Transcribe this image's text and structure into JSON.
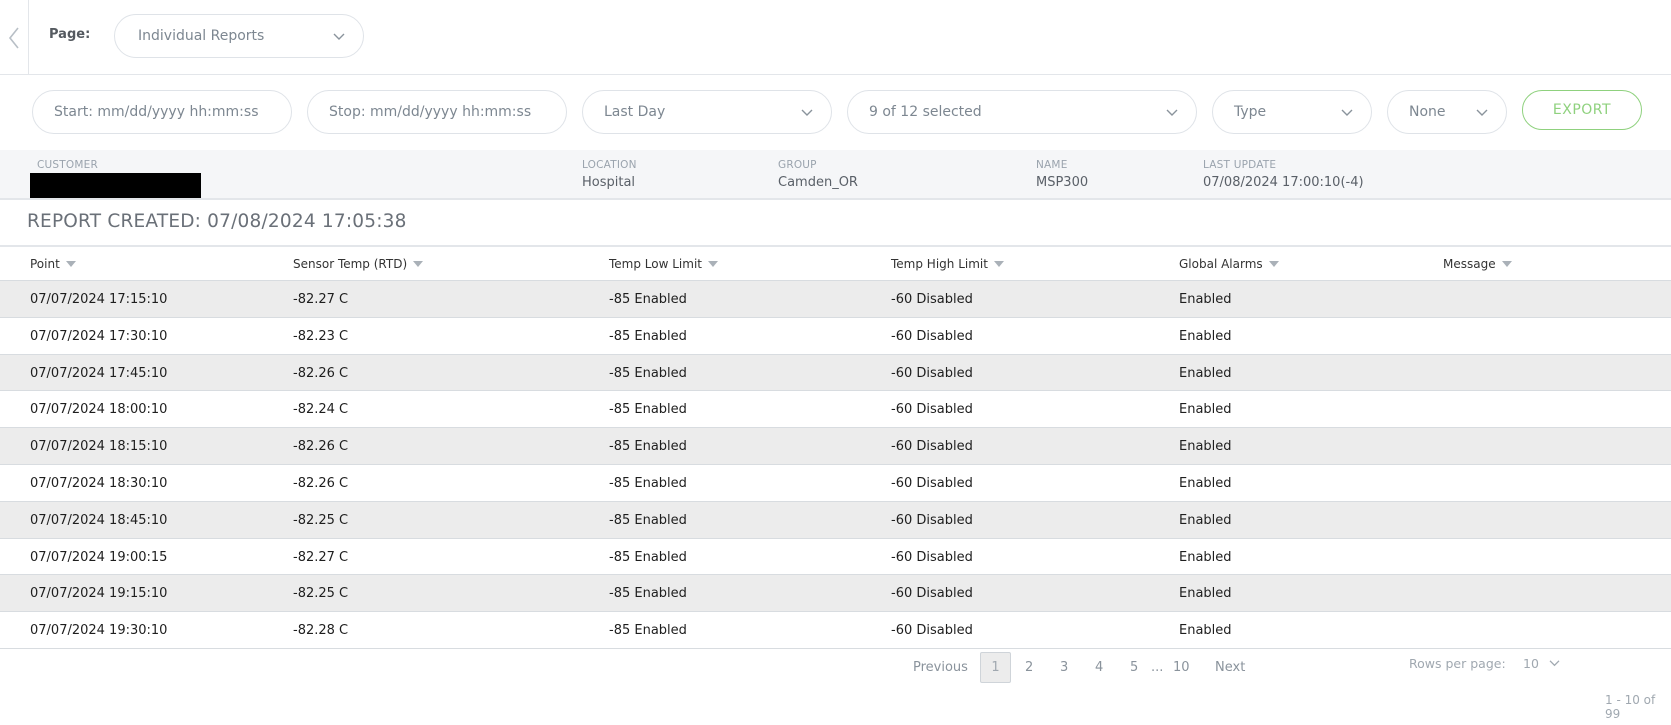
{
  "header": {
    "page_label": "Page:",
    "page_select": "Individual Reports"
  },
  "filters": {
    "start_placeholder": "Start: mm/dd/yyyy hh:mm:ss",
    "stop_placeholder": "Stop: mm/dd/yyyy hh:mm:ss",
    "range": "Last Day",
    "points": "9 of 12 selected",
    "type": "Type",
    "none": "None",
    "export_label": "EXPORT"
  },
  "info": {
    "customer_label": "CUSTOMER",
    "location_label": "LOCATION",
    "location": "Hospital",
    "group_label": "GROUP",
    "group": "Camden_OR",
    "name_label": "NAME",
    "name": "MSP300",
    "last_update_label": "LAST UPDATE",
    "last_update": "07/08/2024 17:00:10(-4)"
  },
  "report_created": "REPORT CREATED: 07/08/2024 17:05:38",
  "table": {
    "columns": [
      "Point",
      "Sensor Temp (RTD)",
      "Temp Low Limit",
      "Temp High Limit",
      "Global Alarms",
      "Message"
    ],
    "rows": [
      [
        "07/07/2024 17:15:10",
        "-82.27 C",
        "-85 Enabled",
        "-60 Disabled",
        "Enabled",
        ""
      ],
      [
        "07/07/2024 17:30:10",
        "-82.23 C",
        "-85 Enabled",
        "-60 Disabled",
        "Enabled",
        ""
      ],
      [
        "07/07/2024 17:45:10",
        "-82.26 C",
        "-85 Enabled",
        "-60 Disabled",
        "Enabled",
        ""
      ],
      [
        "07/07/2024 18:00:10",
        "-82.24 C",
        "-85 Enabled",
        "-60 Disabled",
        "Enabled",
        ""
      ],
      [
        "07/07/2024 18:15:10",
        "-82.26 C",
        "-85 Enabled",
        "-60 Disabled",
        "Enabled",
        ""
      ],
      [
        "07/07/2024 18:30:10",
        "-82.26 C",
        "-85 Enabled",
        "-60 Disabled",
        "Enabled",
        ""
      ],
      [
        "07/07/2024 18:45:10",
        "-82.25 C",
        "-85 Enabled",
        "-60 Disabled",
        "Enabled",
        ""
      ],
      [
        "07/07/2024 19:00:15",
        "-82.27 C",
        "-85 Enabled",
        "-60 Disabled",
        "Enabled",
        ""
      ],
      [
        "07/07/2024 19:15:10",
        "-82.25 C",
        "-85 Enabled",
        "-60 Disabled",
        "Enabled",
        ""
      ],
      [
        "07/07/2024 19:30:10",
        "-82.28 C",
        "-85 Enabled",
        "-60 Disabled",
        "Enabled",
        ""
      ]
    ]
  },
  "pagination": {
    "previous": "Previous",
    "current": "1",
    "pages": [
      "2",
      "3",
      "4",
      "5"
    ],
    "ellipsis": "...",
    "last": "10",
    "next": "Next",
    "rows_per_page_label": "Rows per page:",
    "rows_per_page": "10",
    "range": "1 - 10 of 99"
  },
  "colors": {
    "accent_export": "#8fd17e",
    "row_alt": "#ececec",
    "info_bg": "#f5f6f8"
  }
}
